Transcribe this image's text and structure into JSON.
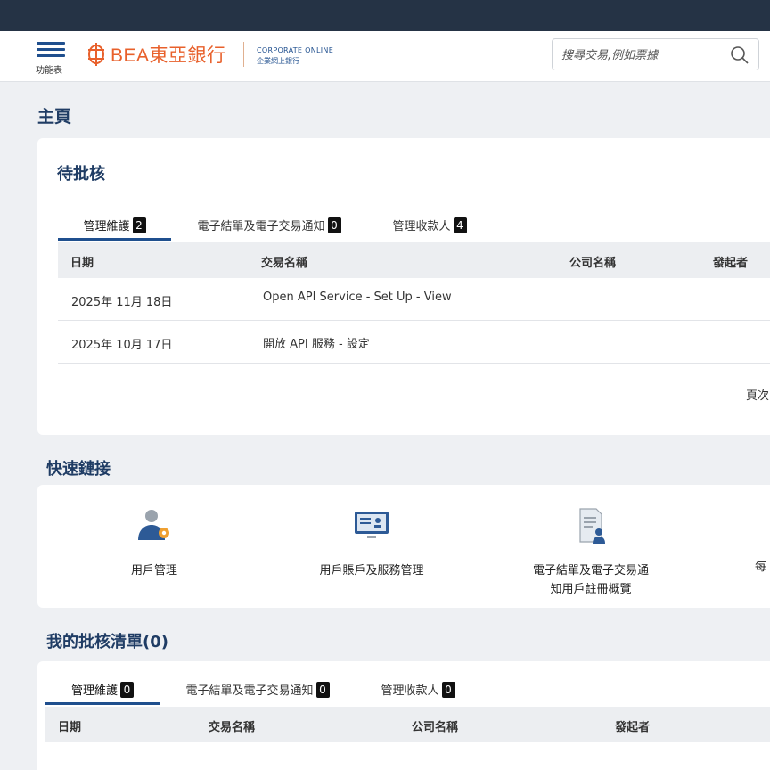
{
  "header": {
    "menu_label": "功能表",
    "logo_text": "BEA東亞銀行",
    "product_line1": "CORPORATE ONLINE",
    "product_line2": "企業網上銀行",
    "search_placeholder": "搜尋交易,例如票據"
  },
  "page": {
    "title": "主頁"
  },
  "pending": {
    "title": "待批核",
    "tabs": [
      {
        "label": "管理維護",
        "count": "2"
      },
      {
        "label": "電子結單及電子交易通知",
        "count": "0"
      },
      {
        "label": "管理收款人",
        "count": "4"
      }
    ],
    "columns": [
      "日期",
      "交易名稱",
      "公司名稱",
      "發起者"
    ],
    "rows": [
      {
        "date": "2025年 11月 18日",
        "name": "Open API Service - Set Up - View"
      },
      {
        "date": "2025年 10月 17日",
        "name": "開放 API 服務 - 設定"
      }
    ],
    "pager_label": "頁次"
  },
  "quick_links": {
    "title": "快速鏈接",
    "items": [
      {
        "label": "用戶管理",
        "icon": "user-gear-icon"
      },
      {
        "label": "用戶賬戶及服務管理",
        "icon": "monitor-accounts-icon"
      },
      {
        "label": "電子結單及電子交易通\n知用戶註冊概覽",
        "icon": "document-user-icon"
      },
      {
        "label": "每",
        "icon": ""
      }
    ]
  },
  "my_approvals": {
    "title": "我的批核清單(0)",
    "tabs": [
      {
        "label": "管理維護",
        "count": "0"
      },
      {
        "label": "電子結單及電子交易通知",
        "count": "0"
      },
      {
        "label": "管理收款人",
        "count": "0"
      }
    ],
    "columns": [
      "日期",
      "交易名稱",
      "公司名稱",
      "發起者"
    ]
  },
  "colors": {
    "navy": "#1f3c64",
    "accent": "#1f4f8e",
    "brand_orange": "#e8602b",
    "topbar": "#253345"
  }
}
